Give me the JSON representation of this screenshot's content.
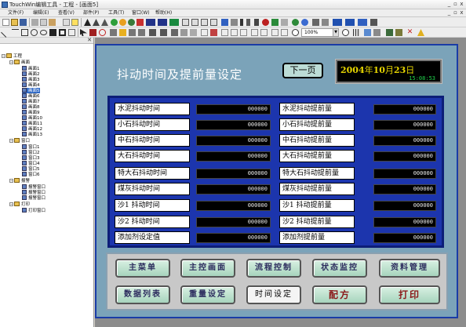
{
  "window": {
    "title": "TouchWin编辑工具 - 工程 - [画面5]",
    "controls": [
      "_",
      "▫",
      "x"
    ]
  },
  "menu": {
    "items": [
      "文件(F)",
      "编辑(E)",
      "查看(V)",
      "部件(P)",
      "工具(T)",
      "窗口(W)",
      "帮助(H)"
    ],
    "controls": [
      "_",
      "▫",
      "x"
    ]
  },
  "toolbar": {
    "zoom_value": "100%"
  },
  "tree": {
    "root": "工程",
    "screens_folder": "画面",
    "screens": [
      "画面1",
      "画面2",
      "画面3",
      "画面4",
      "画面5",
      "画面6",
      "画面7",
      "画面8",
      "画面9",
      "画面10",
      "画面11",
      "画面12",
      "画面13"
    ],
    "selected": "画面5",
    "windows_folder": "窗口",
    "windows": [
      "窗口1",
      "窗口2",
      "窗口3",
      "窗口4",
      "窗口5",
      "窗口6"
    ],
    "alarm_folder": "报警",
    "alarms": [
      "报警窗口",
      "报警窗口",
      "报警窗口"
    ],
    "print_folder": "打印",
    "prints": [
      "打印窗口"
    ]
  },
  "screen": {
    "title": "抖动时间及提前量设定",
    "next_button": "下一页",
    "date_year": "2004",
    "date_year_unit": "年",
    "date_month": "10",
    "date_month_unit": "月",
    "date_day": "23",
    "date_day_unit": "日",
    "time": "15:08:53",
    "rows": [
      {
        "label1": "水泥抖动时间",
        "value1": "000000",
        "label2": "水泥抖动提前量",
        "value2": "000000"
      },
      {
        "label1": "小石抖动时间",
        "value1": "000000",
        "label2": "小石抖动提前量",
        "value2": "000000"
      },
      {
        "label1": "中石抖动时间",
        "value1": "000000",
        "label2": "中石抖动提前量",
        "value2": "000000"
      },
      {
        "label1": "大石抖动时间",
        "value1": "000000",
        "label2": "大石抖动提前量",
        "value2": "000000"
      },
      {
        "label1": "特大石抖动时间",
        "value1": "000000",
        "label2": "特大石抖动提前量",
        "value2": "000000"
      },
      {
        "label1": "煤灰抖动时间",
        "value1": "000000",
        "label2": "煤灰抖动提前量",
        "value2": "000000"
      },
      {
        "label1": "沙1 抖动时间",
        "value1": "000000",
        "label2": "沙1 抖动提前量",
        "value2": "000000"
      },
      {
        "label1": "沙2 抖动时间",
        "value1": "000000",
        "label2": "沙2 抖动提前量",
        "value2": "000000"
      },
      {
        "label1": "添加剂设定值",
        "value1": "000000",
        "label2": "添加剂提前量",
        "value2": "000000"
      }
    ],
    "nav_buttons": [
      "主菜单",
      "主控画面",
      "流程控制",
      "状态监控",
      "资料管理",
      "数据列表",
      "重量设定",
      "时间设定",
      "配方",
      "打印"
    ]
  },
  "colors": {
    "screen_bg": "#7ba3b9",
    "panel_bg": "#1c35ad",
    "date_yellow": "#e5d400",
    "time_green": "#1fd14a"
  }
}
